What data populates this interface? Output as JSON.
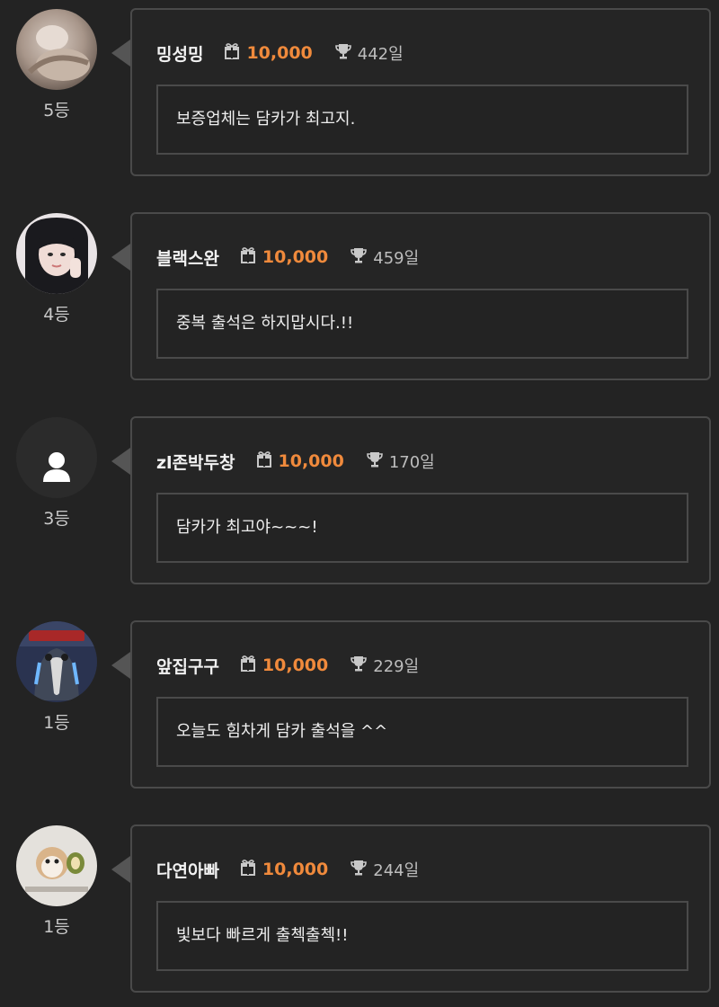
{
  "entries": [
    {
      "name": "밍성밍",
      "gift": "10,000",
      "days": "442일",
      "message": "보증업체는 담카가 최고지.",
      "rank": "5등",
      "avatar": "photo"
    },
    {
      "name": "블랙스완",
      "gift": "10,000",
      "days": "459일",
      "message": "중복 출석은 하지맙시다.!!",
      "rank": "4등",
      "avatar": "photo"
    },
    {
      "name": "zl존박두창",
      "gift": "10,000",
      "days": "170일",
      "message": "담카가 최고야~~~!",
      "rank": "3등",
      "avatar": "default-user-icon"
    },
    {
      "name": "앞집구구",
      "gift": "10,000",
      "days": "229일",
      "message": "오늘도 힘차게 담카 출석을 ^^",
      "rank": "1등",
      "avatar": "photo"
    },
    {
      "name": "다연아빠",
      "gift": "10,000",
      "days": "244일",
      "message": "빛보다 빠르게 출첵출첵!!",
      "rank": "1등",
      "avatar": "photo"
    }
  ],
  "colors": {
    "background": "#232323",
    "border": "#4a4a4a",
    "gift_accent": "#f08a3c",
    "name_text": "#f2f2f2",
    "muted_text": "#bdbdbd"
  },
  "icons": {
    "gift": "gift-icon",
    "trophy": "trophy-icon",
    "default_avatar": "user-icon"
  }
}
